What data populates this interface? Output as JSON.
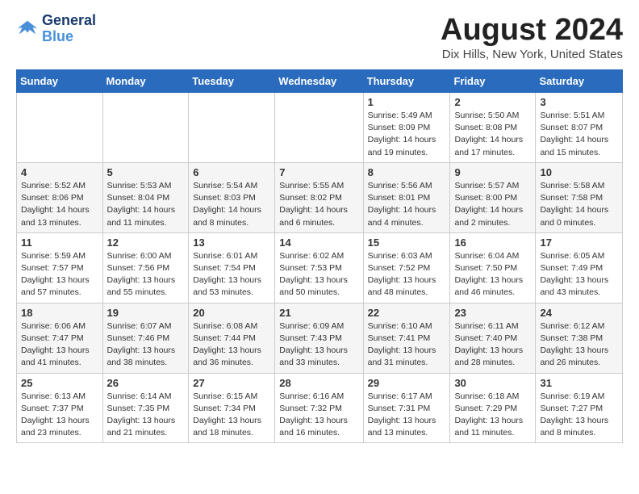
{
  "logo": {
    "line1": "General",
    "line2": "Blue"
  },
  "title": "August 2024",
  "location": "Dix Hills, New York, United States",
  "days_of_week": [
    "Sunday",
    "Monday",
    "Tuesday",
    "Wednesday",
    "Thursday",
    "Friday",
    "Saturday"
  ],
  "weeks": [
    [
      {
        "day": "",
        "info": ""
      },
      {
        "day": "",
        "info": ""
      },
      {
        "day": "",
        "info": ""
      },
      {
        "day": "",
        "info": ""
      },
      {
        "day": "1",
        "info": "Sunrise: 5:49 AM\nSunset: 8:09 PM\nDaylight: 14 hours\nand 19 minutes."
      },
      {
        "day": "2",
        "info": "Sunrise: 5:50 AM\nSunset: 8:08 PM\nDaylight: 14 hours\nand 17 minutes."
      },
      {
        "day": "3",
        "info": "Sunrise: 5:51 AM\nSunset: 8:07 PM\nDaylight: 14 hours\nand 15 minutes."
      }
    ],
    [
      {
        "day": "4",
        "info": "Sunrise: 5:52 AM\nSunset: 8:06 PM\nDaylight: 14 hours\nand 13 minutes."
      },
      {
        "day": "5",
        "info": "Sunrise: 5:53 AM\nSunset: 8:04 PM\nDaylight: 14 hours\nand 11 minutes."
      },
      {
        "day": "6",
        "info": "Sunrise: 5:54 AM\nSunset: 8:03 PM\nDaylight: 14 hours\nand 8 minutes."
      },
      {
        "day": "7",
        "info": "Sunrise: 5:55 AM\nSunset: 8:02 PM\nDaylight: 14 hours\nand 6 minutes."
      },
      {
        "day": "8",
        "info": "Sunrise: 5:56 AM\nSunset: 8:01 PM\nDaylight: 14 hours\nand 4 minutes."
      },
      {
        "day": "9",
        "info": "Sunrise: 5:57 AM\nSunset: 8:00 PM\nDaylight: 14 hours\nand 2 minutes."
      },
      {
        "day": "10",
        "info": "Sunrise: 5:58 AM\nSunset: 7:58 PM\nDaylight: 14 hours\nand 0 minutes."
      }
    ],
    [
      {
        "day": "11",
        "info": "Sunrise: 5:59 AM\nSunset: 7:57 PM\nDaylight: 13 hours\nand 57 minutes."
      },
      {
        "day": "12",
        "info": "Sunrise: 6:00 AM\nSunset: 7:56 PM\nDaylight: 13 hours\nand 55 minutes."
      },
      {
        "day": "13",
        "info": "Sunrise: 6:01 AM\nSunset: 7:54 PM\nDaylight: 13 hours\nand 53 minutes."
      },
      {
        "day": "14",
        "info": "Sunrise: 6:02 AM\nSunset: 7:53 PM\nDaylight: 13 hours\nand 50 minutes."
      },
      {
        "day": "15",
        "info": "Sunrise: 6:03 AM\nSunset: 7:52 PM\nDaylight: 13 hours\nand 48 minutes."
      },
      {
        "day": "16",
        "info": "Sunrise: 6:04 AM\nSunset: 7:50 PM\nDaylight: 13 hours\nand 46 minutes."
      },
      {
        "day": "17",
        "info": "Sunrise: 6:05 AM\nSunset: 7:49 PM\nDaylight: 13 hours\nand 43 minutes."
      }
    ],
    [
      {
        "day": "18",
        "info": "Sunrise: 6:06 AM\nSunset: 7:47 PM\nDaylight: 13 hours\nand 41 minutes."
      },
      {
        "day": "19",
        "info": "Sunrise: 6:07 AM\nSunset: 7:46 PM\nDaylight: 13 hours\nand 38 minutes."
      },
      {
        "day": "20",
        "info": "Sunrise: 6:08 AM\nSunset: 7:44 PM\nDaylight: 13 hours\nand 36 minutes."
      },
      {
        "day": "21",
        "info": "Sunrise: 6:09 AM\nSunset: 7:43 PM\nDaylight: 13 hours\nand 33 minutes."
      },
      {
        "day": "22",
        "info": "Sunrise: 6:10 AM\nSunset: 7:41 PM\nDaylight: 13 hours\nand 31 minutes."
      },
      {
        "day": "23",
        "info": "Sunrise: 6:11 AM\nSunset: 7:40 PM\nDaylight: 13 hours\nand 28 minutes."
      },
      {
        "day": "24",
        "info": "Sunrise: 6:12 AM\nSunset: 7:38 PM\nDaylight: 13 hours\nand 26 minutes."
      }
    ],
    [
      {
        "day": "25",
        "info": "Sunrise: 6:13 AM\nSunset: 7:37 PM\nDaylight: 13 hours\nand 23 minutes."
      },
      {
        "day": "26",
        "info": "Sunrise: 6:14 AM\nSunset: 7:35 PM\nDaylight: 13 hours\nand 21 minutes."
      },
      {
        "day": "27",
        "info": "Sunrise: 6:15 AM\nSunset: 7:34 PM\nDaylight: 13 hours\nand 18 minutes."
      },
      {
        "day": "28",
        "info": "Sunrise: 6:16 AM\nSunset: 7:32 PM\nDaylight: 13 hours\nand 16 minutes."
      },
      {
        "day": "29",
        "info": "Sunrise: 6:17 AM\nSunset: 7:31 PM\nDaylight: 13 hours\nand 13 minutes."
      },
      {
        "day": "30",
        "info": "Sunrise: 6:18 AM\nSunset: 7:29 PM\nDaylight: 13 hours\nand 11 minutes."
      },
      {
        "day": "31",
        "info": "Sunrise: 6:19 AM\nSunset: 7:27 PM\nDaylight: 13 hours\nand 8 minutes."
      }
    ]
  ]
}
